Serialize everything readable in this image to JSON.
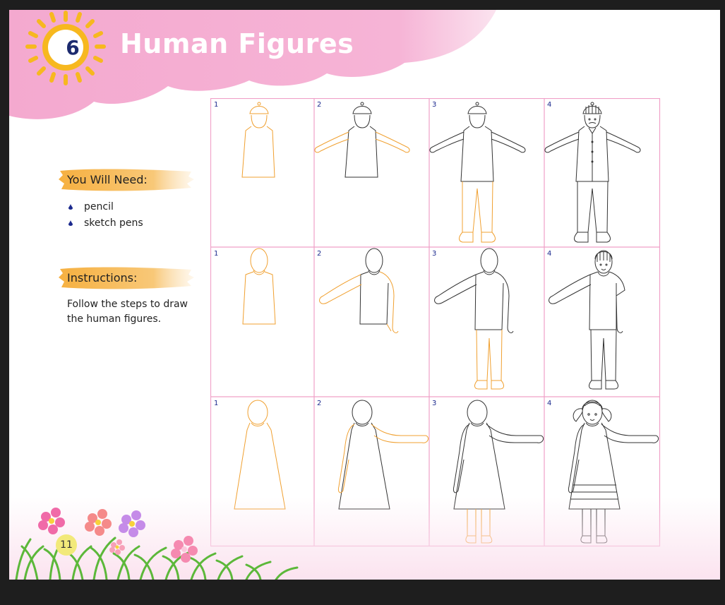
{
  "chapter": {
    "number": "6",
    "title": "Human Figures"
  },
  "you_will_need": {
    "heading": "You Will Need:",
    "items": [
      "pencil",
      "sketch pens"
    ]
  },
  "instructions": {
    "heading": "Instructions:",
    "text": "Follow the steps to draw the human figures."
  },
  "steps": {
    "row1": [
      "1",
      "2",
      "3",
      "4"
    ],
    "row2": [
      "1",
      "2",
      "3",
      "4"
    ],
    "row3": [
      "1",
      "2",
      "3",
      "4"
    ]
  },
  "page_number": "11",
  "colors": {
    "pink": "#f4a9cf",
    "orange": "#f0a030",
    "grid_border": "#f0a0c8",
    "sun": "#f7b81f",
    "ink": "#333333"
  },
  "icons": [
    "sun-icon",
    "drop-bullet-icon",
    "flower-icon",
    "grass-icon"
  ]
}
